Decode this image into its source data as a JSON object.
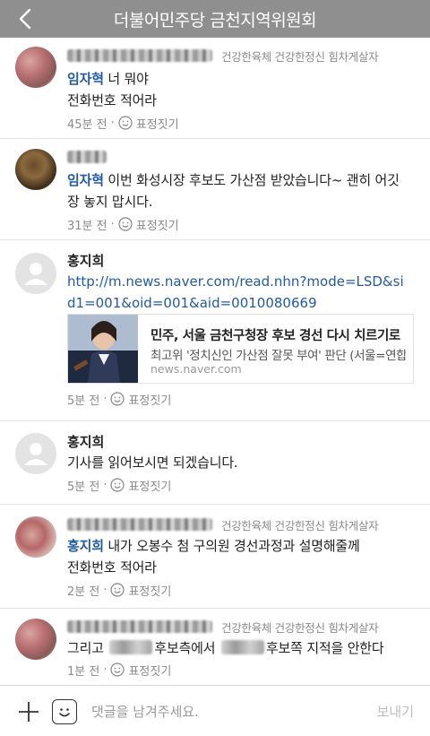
{
  "header": {
    "title": "더불어민주당 금천지역위원회"
  },
  "comments": [
    {
      "name": "",
      "tags": "건강한육체 건강한정신 힘차게살자",
      "mention": "임자혁",
      "line1": " 너 뭐야",
      "line2": "전화번호 적어라",
      "time": "45분 전",
      "react_label": "표정짓기"
    },
    {
      "name": "",
      "tags": "",
      "mention": "임자혁",
      "line1": " 이번 화성시장 후보도 가산점 받았습니다~ 괜히 어깃",
      "line2": "장 놓지 맙시다.",
      "time": "31분 전",
      "react_label": "표정짓기"
    },
    {
      "name": "홍지희",
      "link": "http://m.news.naver.com/read.nhn?mode=LSD&sid1=001&oid=001&aid=0010080669",
      "preview": {
        "title": "민주, 서울 금천구청장 후보 경선 다시 치르기로",
        "desc": "최고위 '정치신인 가산점 잘못 부여' 판단 (서울=연합뉴스)",
        "domain": "news.naver.com"
      },
      "time": "5분 전",
      "react_label": "표정짓기"
    },
    {
      "name": "홍지희",
      "line1": "기사를 읽어보시면 되겠습니다.",
      "time": "5분 전",
      "react_label": "표정짓기"
    },
    {
      "name": "",
      "tags": "건강한육체 건강한정신 힘차게살자",
      "mention": "홍지희",
      "line1": " 내가 오봉수 첨 구의원 경선과정과 설명해줄께",
      "line2": "전화번호 적어라",
      "time": "2분 전",
      "react_label": "표정짓기"
    },
    {
      "name": "",
      "tags": "건강한육체 건강한정신 힘차게살자",
      "line1_a": "그리고 ",
      "line1_b": "후보측에서 ",
      "line1_c": "후보쪽 지적을 안한다",
      "time": "1분 전",
      "react_label": "표정짓기"
    }
  ],
  "input": {
    "placeholder": "댓글을 남겨주세요.",
    "send_label": "보내기"
  },
  "colors": {
    "header_bg": "#8f8f8f",
    "mention": "#1f5aa8",
    "meta": "#8a8a8a"
  }
}
